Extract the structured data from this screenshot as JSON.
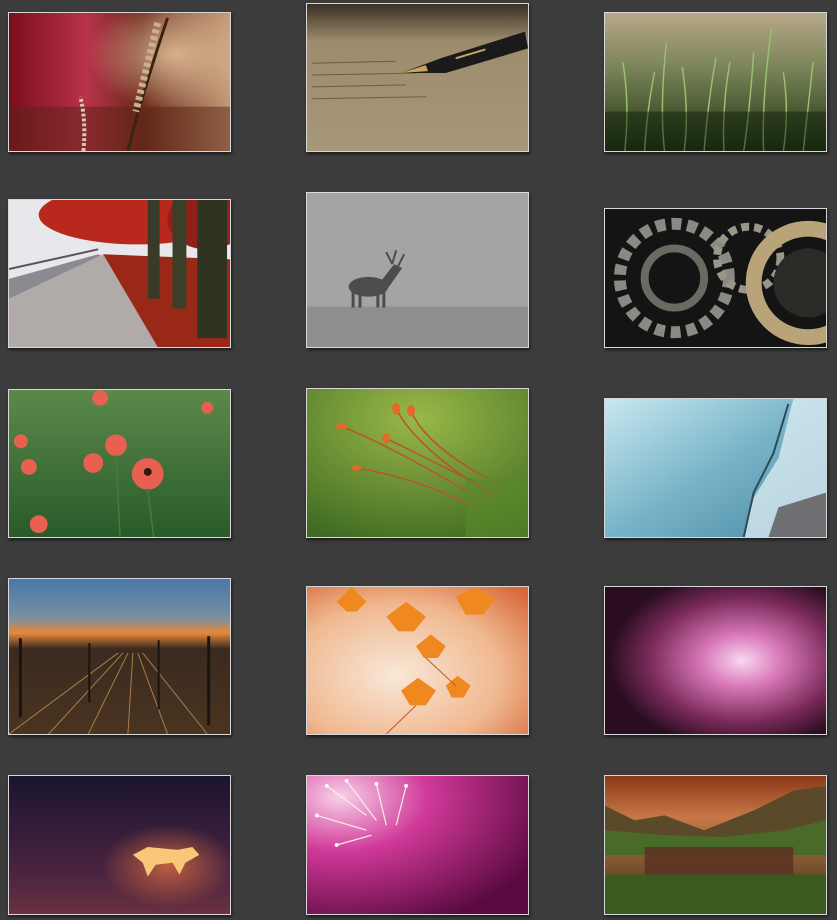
{
  "view": {
    "background_color": "#3c3c3c",
    "thumbnail_border_color": "#d8d8d8"
  },
  "thumbnails": [
    {
      "subject": "wheat-stalks-red-bokeh"
    },
    {
      "subject": "fountain-pen-on-letter"
    },
    {
      "subject": "green-grass-closeup"
    },
    {
      "subject": "red-tree-lined-promenade"
    },
    {
      "subject": "deer-silhouette-in-fog"
    },
    {
      "subject": "gear-mechanism"
    },
    {
      "subject": "red-poppies-field"
    },
    {
      "subject": "moss-sporophytes-macro"
    },
    {
      "subject": "icy-blue-rock-face"
    },
    {
      "subject": "railway-yard-at-dusk"
    },
    {
      "subject": "orange-maple-leaves"
    },
    {
      "subject": "purple-light-bokeh"
    },
    {
      "subject": "glowing-origami-cat"
    },
    {
      "subject": "pink-flower-macro"
    },
    {
      "subject": "mountain-lake-at-sunset"
    }
  ]
}
